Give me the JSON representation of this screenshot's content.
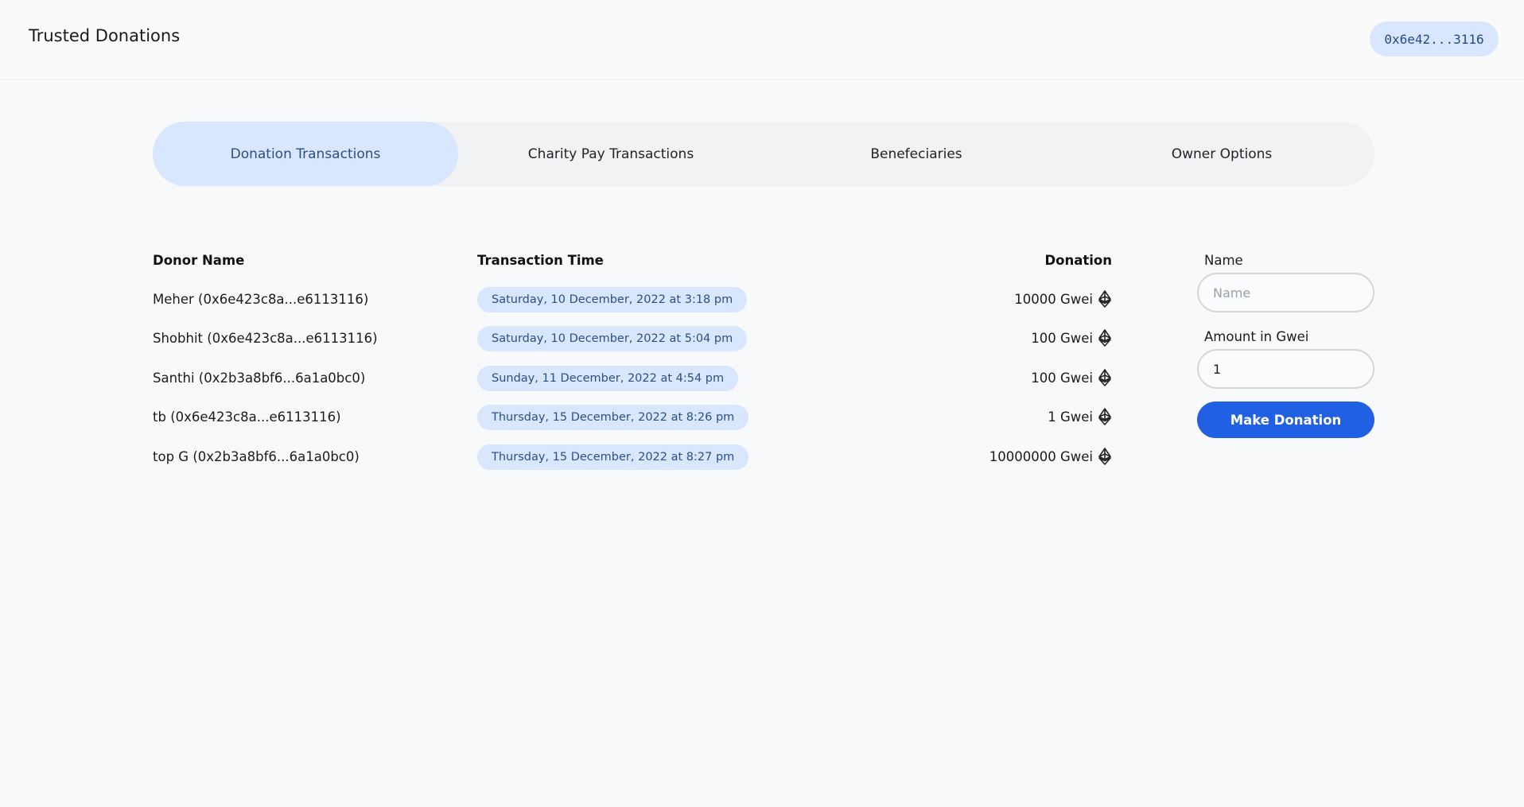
{
  "header": {
    "title": "Trusted Donations",
    "wallet": "0x6e42...3116"
  },
  "tabs": [
    {
      "label": "Donation Transactions",
      "active": true
    },
    {
      "label": "Charity Pay Transactions",
      "active": false
    },
    {
      "label": "Benefeciaries",
      "active": false
    },
    {
      "label": "Owner Options",
      "active": false
    }
  ],
  "table": {
    "headers": {
      "donor": "Donor Name",
      "time": "Transaction Time",
      "donation": "Donation"
    },
    "rows": [
      {
        "donor": "Meher (0x6e423c8a...e6113116)",
        "time": "Saturday, 10 December, 2022 at 3:18 pm",
        "donation": "10000 Gwei"
      },
      {
        "donor": "Shobhit (0x6e423c8a...e6113116)",
        "time": "Saturday, 10 December, 2022 at 5:04 pm",
        "donation": "100 Gwei"
      },
      {
        "donor": "Santhi (0x2b3a8bf6...6a1a0bc0)",
        "time": "Sunday, 11 December, 2022 at 4:54 pm",
        "donation": "100 Gwei"
      },
      {
        "donor": "tb (0x6e423c8a...e6113116)",
        "time": "Thursday, 15 December, 2022 at 8:26 pm",
        "donation": "1 Gwei"
      },
      {
        "donor": "top G (0x2b3a8bf6...6a1a0bc0)",
        "time": "Thursday, 15 December, 2022 at 8:27 pm",
        "donation": "10000000 Gwei"
      }
    ],
    "donation_icon": "ethereum-icon"
  },
  "form": {
    "name_label": "Name",
    "name_placeholder": "Name",
    "name_value": "",
    "amount_label": "Amount in Gwei",
    "amount_value": "1",
    "submit_label": "Make Donation"
  },
  "colors": {
    "accent": "#2160e2",
    "pill_bg": "#d8e7fd",
    "pill_text": "#2b4f86",
    "page_bg": "#f8f9fb"
  }
}
